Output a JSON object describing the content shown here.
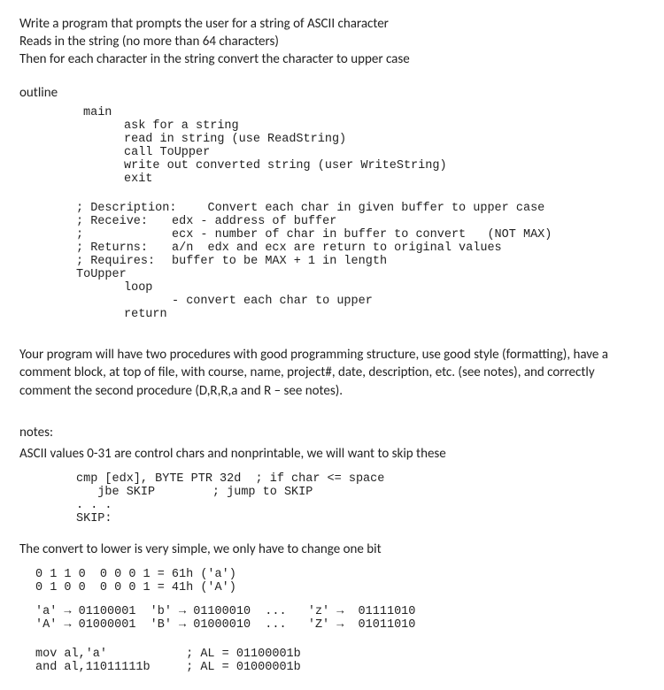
{
  "intro": {
    "line1": "Write a program that prompts the user for a string of ASCII character",
    "line2": "Reads in the string  (no more than 64 characters)",
    "line3": "Then for each character in the string convert the character to upper case"
  },
  "outline": {
    "heading": "outline",
    "main_label": "main",
    "main_steps": [
      "ask for a string",
      "read in string (use ReadString)",
      "call ToUpper",
      "write out converted string (user WriteString)",
      "exit"
    ],
    "description": {
      "desc_label": "; Description:",
      "desc_text": "     Convert each char in given buffer to upper case",
      "receive_label": "; Receive:",
      "receive_text1": "edx - address of buffer",
      "semi": ";",
      "receive_text2": "ecx - number of char in buffer to convert   (NOT MAX)",
      "returns_label": "; Returns:",
      "returns_text": "a/n  edx and ecx are return to original values",
      "requires_label": "; Requires:",
      "requires_text": "buffer to be MAX + 1 in length",
      "proc_name": "ToUpper",
      "loop_label": "loop",
      "loop_body": "- convert each char to upper",
      "return_label": "return"
    }
  },
  "paragraph": "Your program will have two procedures with good programming structure, use good style (formatting), have a comment block, at top of file, with course, name, project#, date, description, etc. (see notes), and correctly comment the second procedure (D,R,R,a and R – see notes).",
  "notes": {
    "heading": "notes:",
    "line1": "ASCII values 0-31 are control chars and nonprintable, we will want to skip these",
    "code_lines": [
      "cmp [edx], BYTE PTR 32d  ; if char <= space",
      "   jbe SKIP        ; jump to SKIP",
      ". . .",
      "SKIP:"
    ],
    "convert_line": "The convert to lower is very simple, we only have to change one bit",
    "bit_lines": [
      "0 1 1 0  0 0 0 1 = 61h ('a')",
      "0 1 0 0  0 0 0 1 = 41h ('A')"
    ],
    "arrow_lines": [
      "'a' → 01100001  'b' → 01100010  ...   'z' →  01111010",
      "'A' → 01000001  'B' → 01000010  ...   'Z' →  01011010"
    ],
    "mov_lines": [
      "mov al,'a'           ; AL = 01100001b",
      "and al,11011111b     ; AL = 01000001b"
    ]
  }
}
